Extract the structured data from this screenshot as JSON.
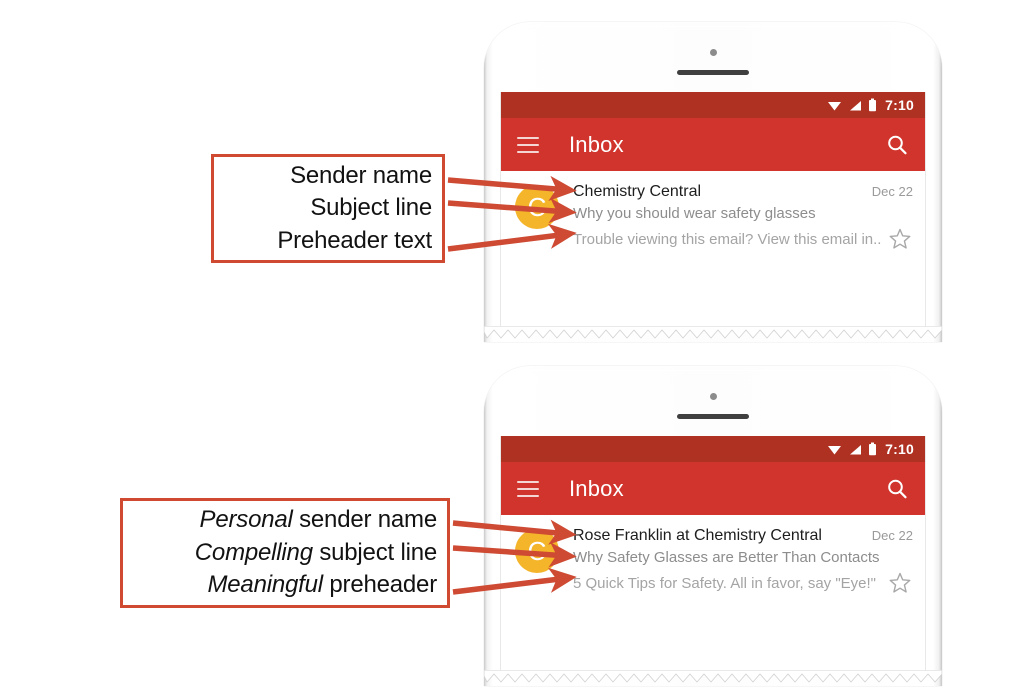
{
  "page": {
    "background_color": "#ffffff",
    "accent_color": "#D04A32"
  },
  "callouts": [
    {
      "name": "basic-labels",
      "lines": [
        {
          "emphasis": "",
          "rest": "Sender name"
        },
        {
          "emphasis": "",
          "rest": "Subject line"
        },
        {
          "emphasis": "",
          "rest": "Preheader text"
        }
      ]
    },
    {
      "name": "improved-labels",
      "lines": [
        {
          "emphasis": "Personal",
          "rest": " sender name"
        },
        {
          "emphasis": "Compelling",
          "rest": " subject line"
        },
        {
          "emphasis": "Meaningful",
          "rest": " preheader"
        }
      ]
    }
  ],
  "phones": [
    {
      "name": "phone-before",
      "status_bar": {
        "time": "7:10",
        "icons": [
          "wifi-icon",
          "signal-icon",
          "battery-icon"
        ],
        "background_color": "#AF3122"
      },
      "app_bar": {
        "menu_icon": "hamburger-icon",
        "title": "Inbox",
        "search_icon": "search-icon",
        "background_color": "#D0342C"
      },
      "mail": {
        "avatar_letter": "C",
        "avatar_color": "#F4B52A",
        "sender": "Chemistry Central",
        "date": "Dec 22",
        "subject": "Why you should wear safety glasses",
        "preheader": "Trouble viewing this email? View this email in...",
        "star_icon": "star-outline-icon"
      }
    },
    {
      "name": "phone-after",
      "status_bar": {
        "time": "7:10",
        "icons": [
          "wifi-icon",
          "signal-icon",
          "battery-icon"
        ],
        "background_color": "#AF3122"
      },
      "app_bar": {
        "menu_icon": "hamburger-icon",
        "title": "Inbox",
        "search_icon": "search-icon",
        "background_color": "#D0342C"
      },
      "mail": {
        "avatar_letter": "C",
        "avatar_color": "#F4B52A",
        "sender": "Rose Franklin at Chemistry Central",
        "date": "Dec 22",
        "subject": "Why Safety Glasses are Better Than Contacts",
        "preheader": "5 Quick Tips for Safety. All in favor, say \"Eye!\"",
        "star_icon": "star-outline-icon"
      }
    }
  ]
}
